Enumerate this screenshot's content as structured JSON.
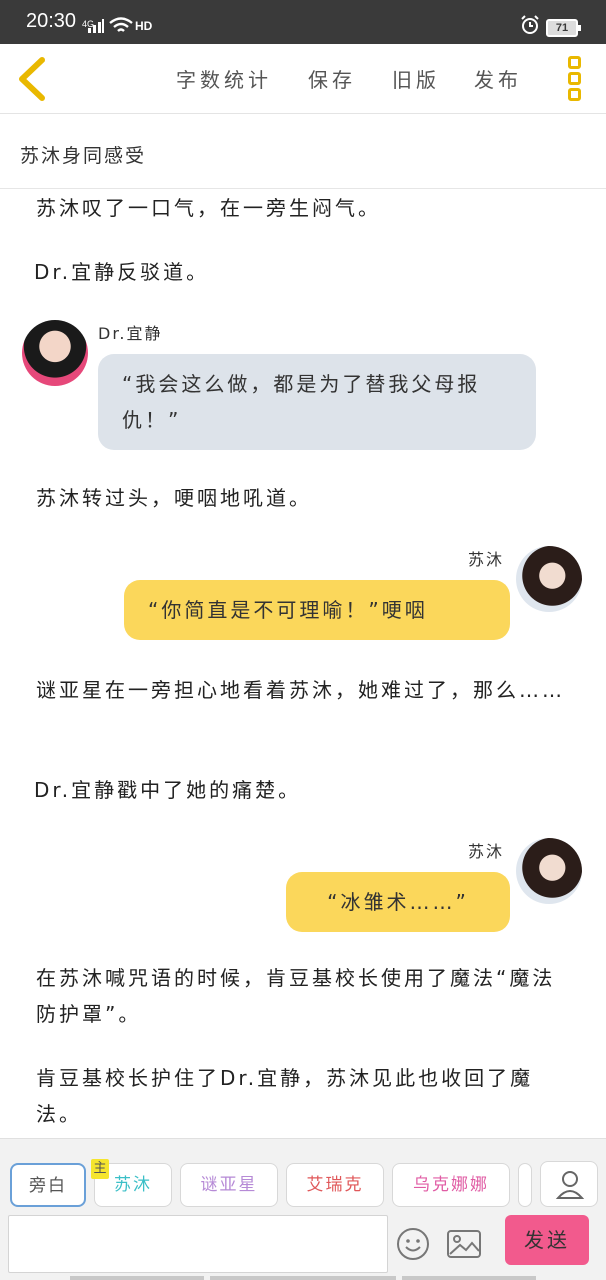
{
  "status_bar": {
    "time": "20:30",
    "network": "4G",
    "hd": "HD",
    "battery": "71"
  },
  "toolbar": {
    "word_count": "字数统计",
    "save": "保存",
    "old_version": "旧版",
    "publish": "发布"
  },
  "chapter": {
    "title": "苏沐身同感受"
  },
  "story": {
    "p1": "苏沐叹了一口气，在一旁生闷气。",
    "p2": "Dr.宜静反驳道。",
    "m1_speaker": "Dr.宜静",
    "m1_text": "“我会这么做，都是为了替我父母报仇！”",
    "p3": "苏沐转过头，哽咽地吼道。",
    "m2_speaker": "苏沐",
    "m2_text": "“你简直是不可理喻！”哽咽",
    "p4": "谜亚星在一旁担心地看着苏沐，她难过了，那么……",
    "p5": "Dr.宜静戳中了她的痛楚。",
    "m3_speaker": "苏沐",
    "m3_text": "“冰雏术……”",
    "p6": "在苏沐喊咒语的时候，肯豆基校长使用了魔法“魔法防护罩”。",
    "p7": "肯豆基校长护住了Dr.宜静，苏沐见此也收回了魔法。"
  },
  "roles": {
    "narration": "旁白",
    "main_tag": "主",
    "sumu": "苏沐",
    "miyaxing": "谜亚星",
    "airuike": "艾瑞克",
    "wukenana": "乌克娜娜"
  },
  "composer": {
    "input_value": "",
    "send": "发送"
  },
  "colors": {
    "accent": "#e9b800",
    "bubble_grey": "#dde3ea",
    "bubble_yellow": "#fbd75b",
    "send": "#f25a8d"
  }
}
